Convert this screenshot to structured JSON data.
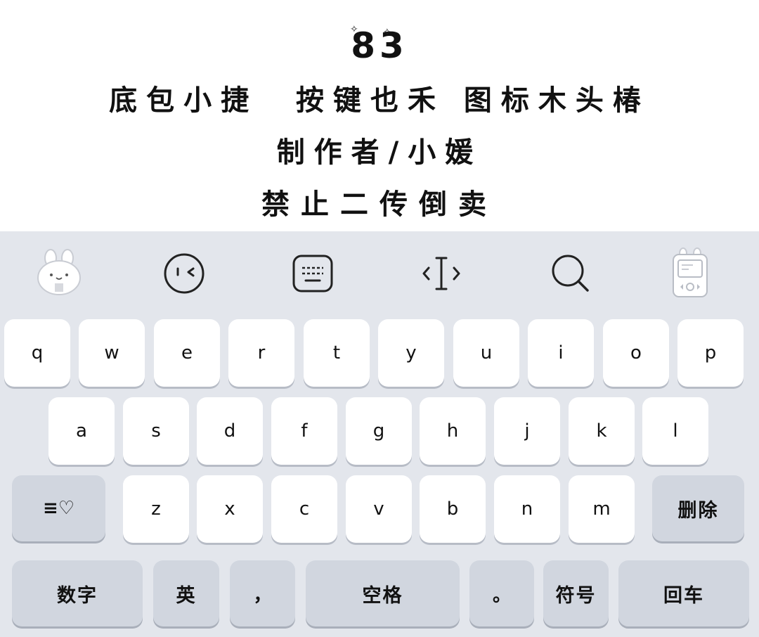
{
  "banner": {
    "number": "83",
    "line2": "底包小捷  按键也禾 图标木头椿",
    "line3": "制作者/小媛",
    "line4": "禁止二传倒卖"
  },
  "toolbar": {
    "icons": [
      "bunny-icon",
      "wink-face-icon",
      "keyboard-icon",
      "cursor-icon",
      "search-icon",
      "gameboy-icon"
    ]
  },
  "keyboard": {
    "row1": [
      "q",
      "w",
      "e",
      "r",
      "t",
      "y",
      "u",
      "i",
      "o",
      "p"
    ],
    "row2": [
      "a",
      "s",
      "d",
      "f",
      "g",
      "h",
      "j",
      "k",
      "l"
    ],
    "row3": [
      "z",
      "x",
      "c",
      "v",
      "b",
      "n",
      "m"
    ],
    "shift_label": "≡♡",
    "delete_label": "删除",
    "numbers_label": "数字",
    "english_label": "英",
    "comma_label": "，",
    "space_label": "空格",
    "period_label": "。",
    "symbols_label": "符号",
    "return_label": "回车"
  }
}
